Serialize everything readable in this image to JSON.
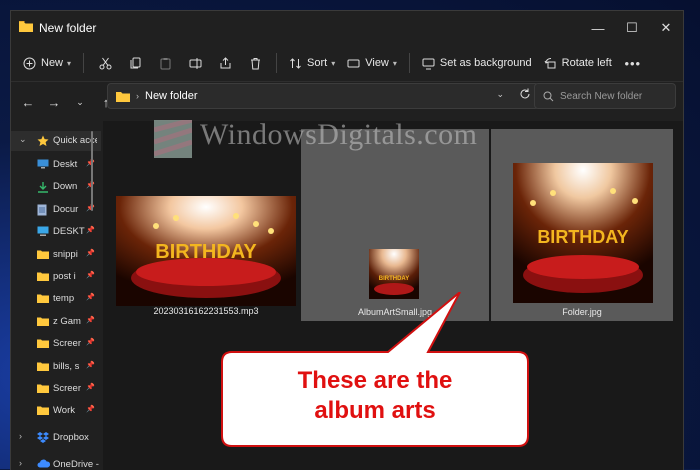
{
  "window": {
    "title": "New folder"
  },
  "toolbar": {
    "new_label": "New",
    "sort_label": "Sort",
    "view_label": "View",
    "set_bg_label": "Set as background",
    "rotate_label": "Rotate left"
  },
  "address": {
    "path": "New folder",
    "search_placeholder": "Search New folder"
  },
  "sidebar": {
    "quick_access": "Quick acce",
    "items": [
      {
        "label": "Deskt",
        "icon": "desktop-icon"
      },
      {
        "label": "Down",
        "icon": "download-icon"
      },
      {
        "label": "Docur",
        "icon": "document-icon"
      },
      {
        "label": "DESKT",
        "icon": "computer-icon"
      },
      {
        "label": "snippi",
        "icon": "folder-icon"
      },
      {
        "label": "post i",
        "icon": "folder-icon"
      },
      {
        "label": "temp",
        "icon": "folder-icon"
      },
      {
        "label": "z Gam",
        "icon": "folder-icon"
      },
      {
        "label": "Screer",
        "icon": "folder-icon"
      },
      {
        "label": "bills, s",
        "icon": "folder-icon"
      },
      {
        "label": "Screer",
        "icon": "folder-icon"
      },
      {
        "label": "Work",
        "icon": "folder-icon"
      }
    ],
    "dropbox": "Dropbox",
    "onedrive": "OneDrive -"
  },
  "files": [
    {
      "name": "20230316162231553.mp3",
      "cake_text": "BIRTHDAY"
    },
    {
      "name": "AlbumArtSmall.jpg"
    },
    {
      "name": "Folder.jpg",
      "cake_text": "BIRTHDAY"
    }
  ],
  "watermark": "WindowsDigitals.com",
  "callout": {
    "line1": "These are the",
    "line2": "album arts"
  },
  "colors": {
    "callout_text": "#e01010",
    "accent": "#ffc83d"
  }
}
